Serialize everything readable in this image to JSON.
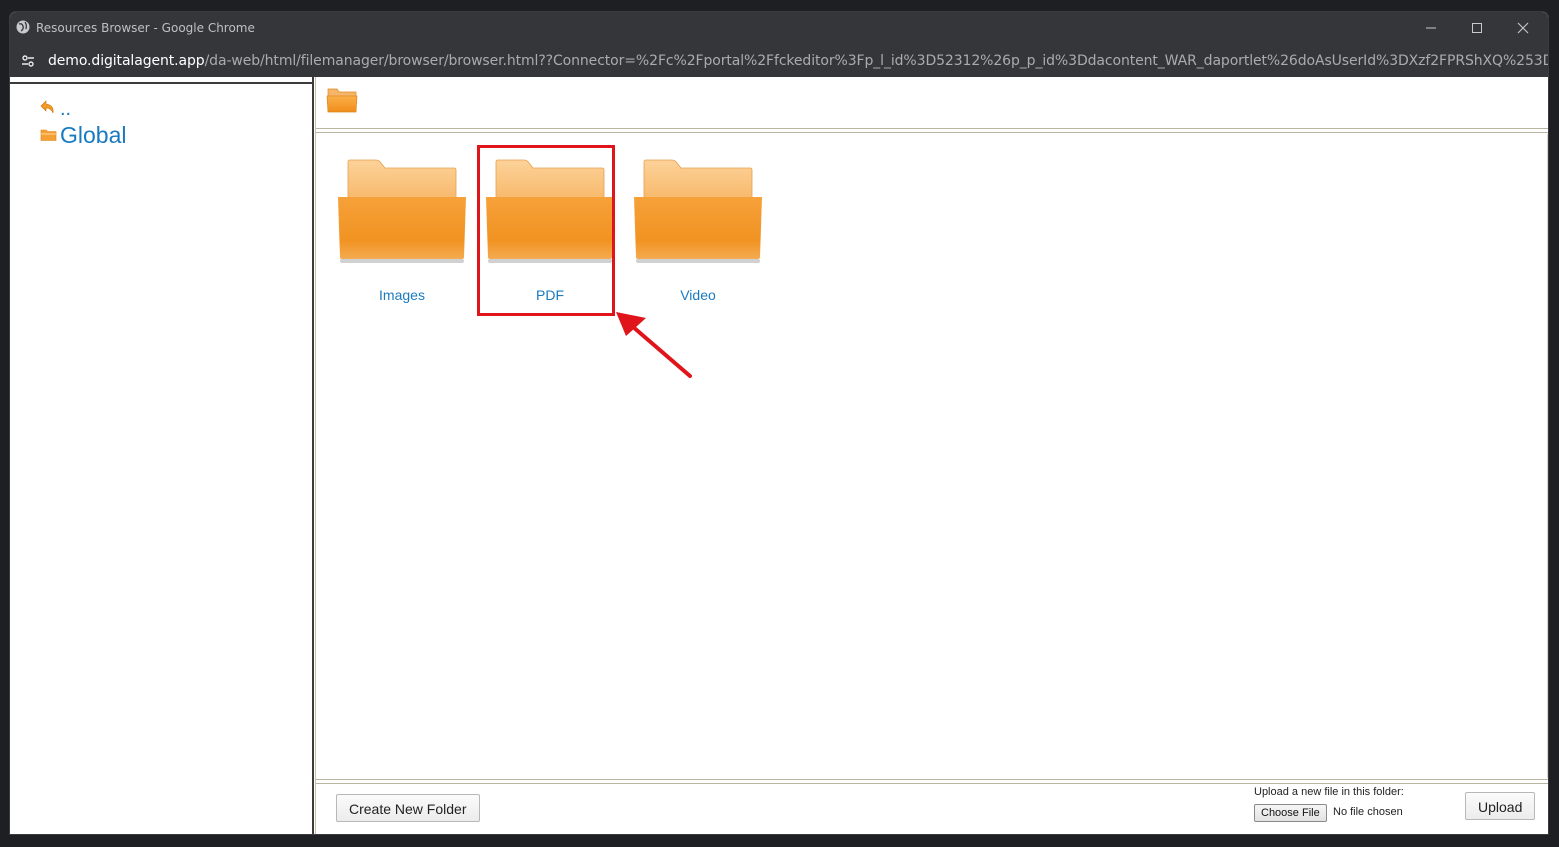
{
  "window": {
    "title": "Resources Browser - Google Chrome",
    "controls": [
      "minimize",
      "maximize",
      "close"
    ]
  },
  "address_bar": {
    "host": "demo.digitalagent.app",
    "path": "/da-web/html/filemanager/browser/browser.html??Connector=%2Fc%2Fportal%2Ffckeditor%3Fp_l_id%3D52312%26p_p_id%3Ddacontent_WAR_daportlet%26doAsUserId%3DXzf2FPRShXQ%253D%26doAsGroupId%..."
  },
  "tree": {
    "up_label": "..",
    "root_label": "Global"
  },
  "folders": [
    {
      "name": "Images"
    },
    {
      "name": "PDF"
    },
    {
      "name": "Video"
    }
  ],
  "annotation": {
    "highlighted_folder": "PDF",
    "color": "#e0141b"
  },
  "footer": {
    "create_folder_label": "Create New Folder",
    "upload_caption": "Upload a new file in this folder:",
    "choose_file_label": "Choose File",
    "no_file_text": "No file chosen",
    "upload_label": "Upload"
  },
  "colors": {
    "link": "#1a7ac0",
    "folder": "#f5a032",
    "chrome_bar": "#35363a"
  }
}
